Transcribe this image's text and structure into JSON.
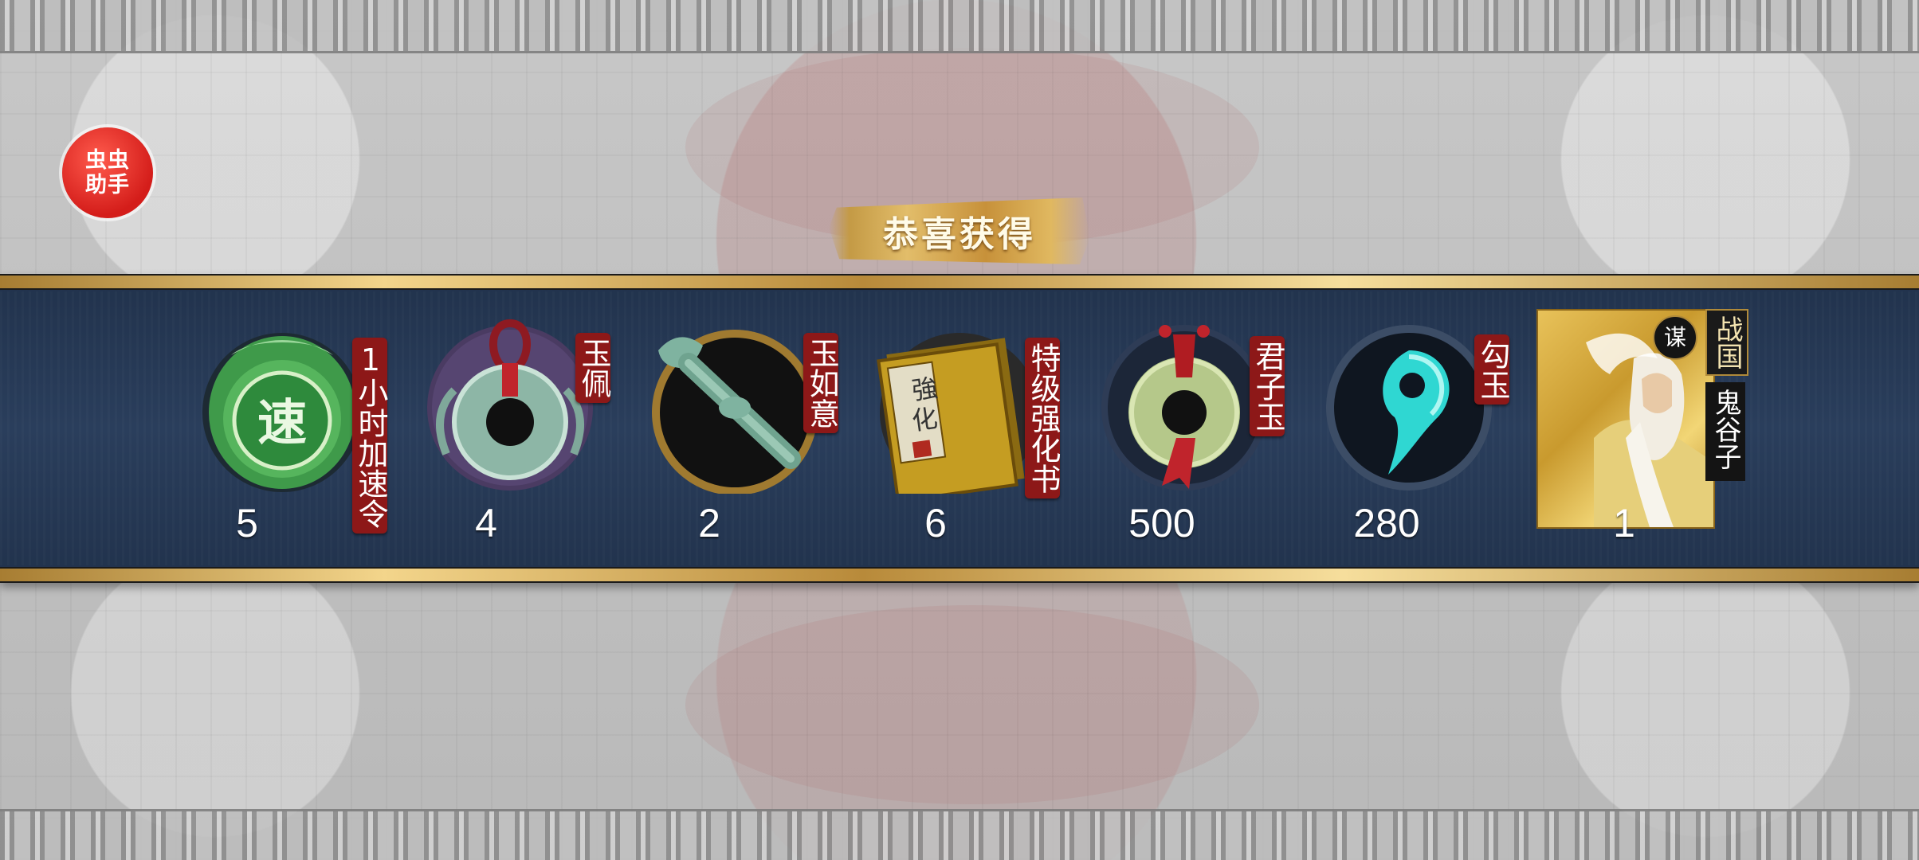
{
  "helper": {
    "label": "虫虫\n助手"
  },
  "title": "恭喜获得",
  "rewards": [
    {
      "name": "1小时加速令",
      "count": "5",
      "icon": "speedup-token-icon"
    },
    {
      "name": "玉佩",
      "count": "4",
      "icon": "jade-pendant-icon"
    },
    {
      "name": "玉如意",
      "count": "2",
      "icon": "jade-ruyi-icon"
    },
    {
      "name": "特级强化书",
      "count": "6",
      "icon": "enhance-book-icon"
    },
    {
      "name": "君子玉",
      "count": "500",
      "icon": "gentleman-jade-icon"
    },
    {
      "name": "勾玉",
      "count": "280",
      "icon": "magatama-icon"
    }
  ],
  "hero": {
    "faction": "战国",
    "name": "鬼谷子",
    "class": "谋",
    "count": "1"
  },
  "colors": {
    "band": "#24364f",
    "gold": "#e2bd6a",
    "tag_red": "#8d1818",
    "helper_red": "#e02a22"
  }
}
